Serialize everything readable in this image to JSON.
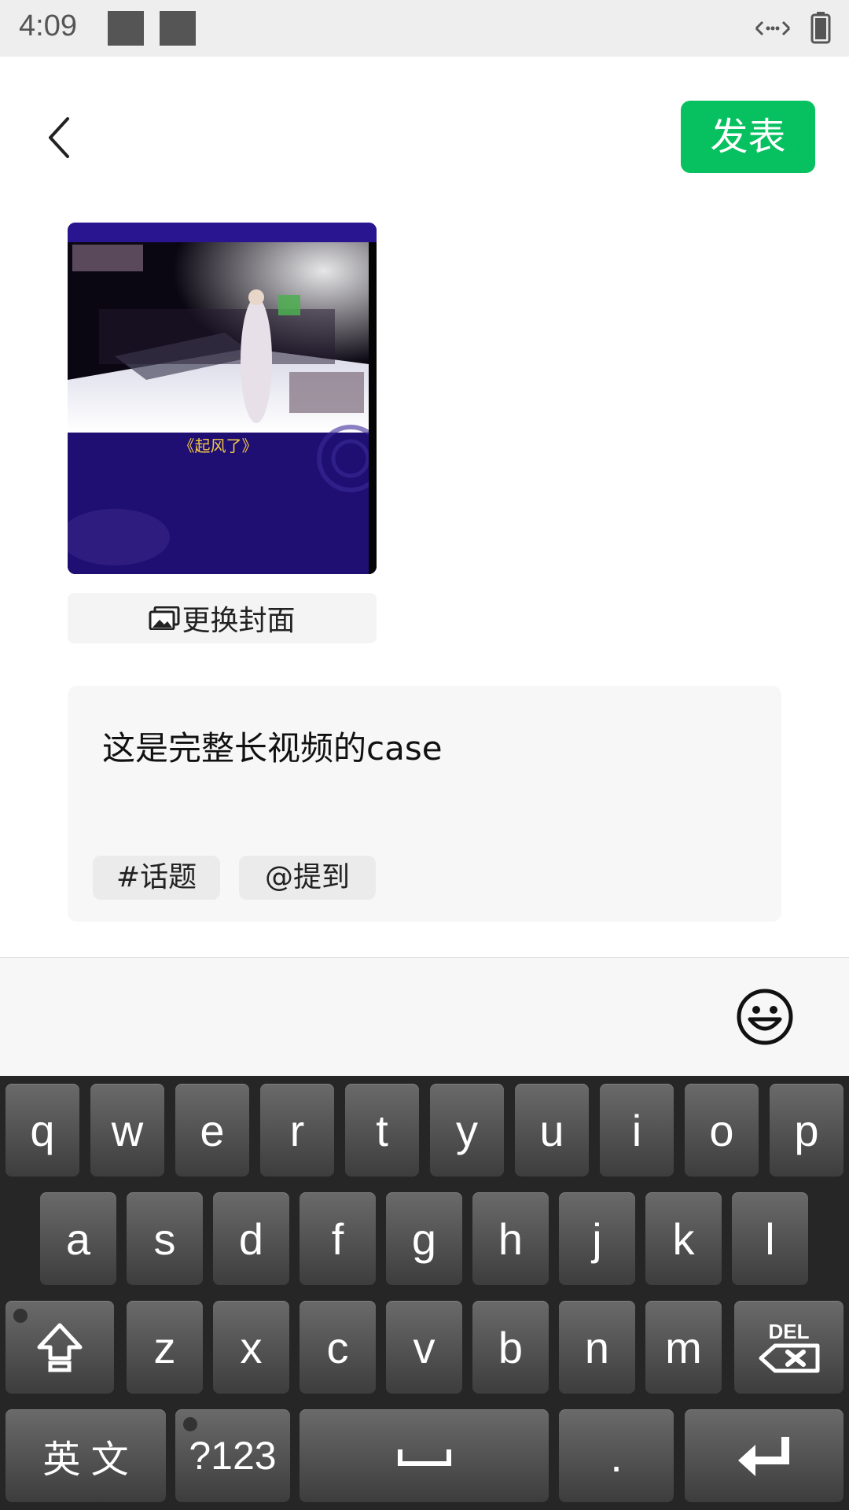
{
  "status_bar": {
    "time": "4:09"
  },
  "header": {
    "publish_label": "发表"
  },
  "cover": {
    "title_text": "《起风了》",
    "change_cover_label": "更换封面"
  },
  "caption": {
    "text": "这是完整长视频的case",
    "tags": [
      {
        "label": "#话题"
      },
      {
        "label": "@提到"
      }
    ]
  },
  "keyboard": {
    "row1": [
      "q",
      "w",
      "e",
      "r",
      "t",
      "y",
      "u",
      "i",
      "o",
      "p"
    ],
    "row2": [
      "a",
      "s",
      "d",
      "f",
      "g",
      "h",
      "j",
      "k",
      "l"
    ],
    "row3": [
      "z",
      "x",
      "c",
      "v",
      "b",
      "n",
      "m"
    ],
    "del_label": "DEL",
    "lang_label": "英 文",
    "symbols_label": "?123",
    "period_label": "."
  },
  "colors": {
    "accent": "#07c160",
    "keyboard_bg": "#262626"
  },
  "icons": [
    "back-icon",
    "image-icon",
    "emoji-icon",
    "shift-icon",
    "backspace-icon",
    "space-icon",
    "enter-icon",
    "sync-icon",
    "battery-icon"
  ]
}
